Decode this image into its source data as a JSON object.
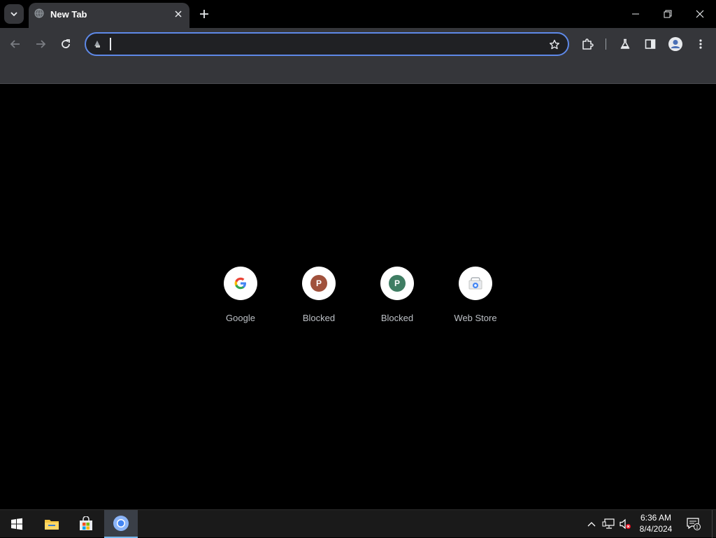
{
  "browser": {
    "tab": {
      "title": "New Tab",
      "favicon": "globe-icon"
    },
    "omnibox": {
      "value": "",
      "placeholder": ""
    },
    "accent_color": "#5e89e8"
  },
  "shortcuts": [
    {
      "label": "Google",
      "icon": "google-g-icon"
    },
    {
      "label": "Blocked",
      "icon": "letter-p-icon",
      "letter": "P",
      "color": "#a0513c"
    },
    {
      "label": "Blocked",
      "icon": "letter-p-icon",
      "letter": "P",
      "color": "#3f7d63"
    },
    {
      "label": "Web Store",
      "icon": "web-store-icon"
    }
  ],
  "taskbar": {
    "apps": [
      "start-icon",
      "file-explorer-icon",
      "microsoft-store-icon",
      "chrome-icon"
    ],
    "clock": {
      "time": "6:36 AM",
      "date": "8/4/2024"
    },
    "notifications": {
      "count": "1"
    }
  }
}
